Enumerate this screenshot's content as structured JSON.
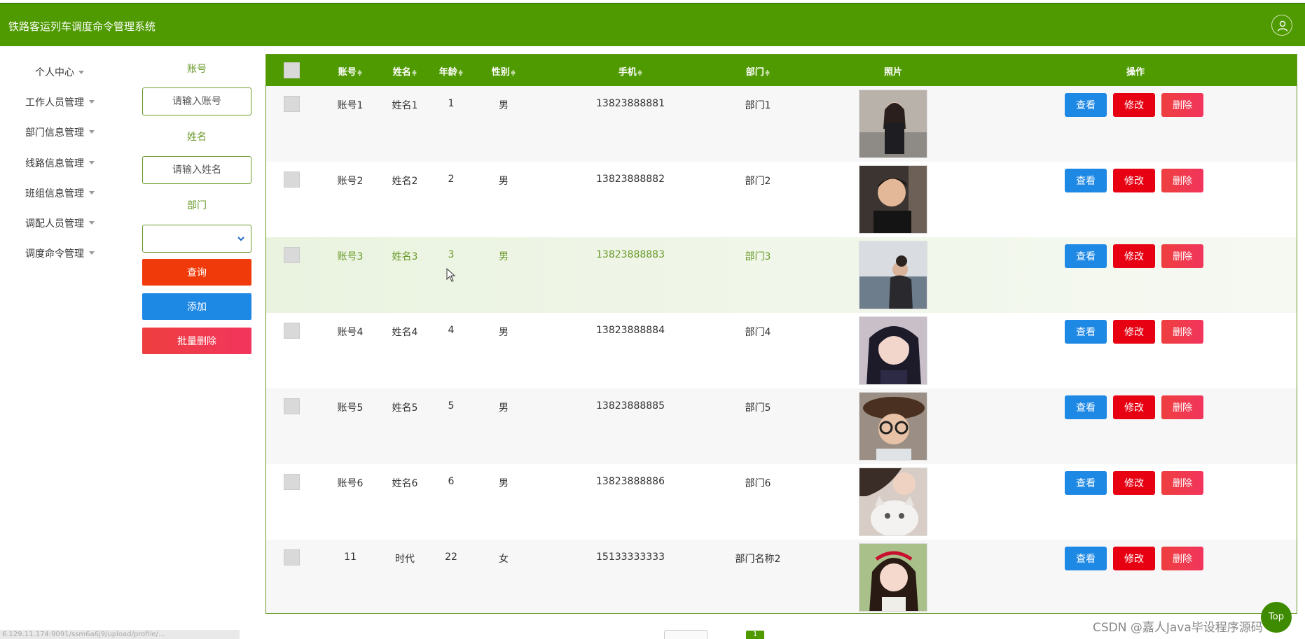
{
  "header": {
    "title": "铁路客运列车调度命令管理系统",
    "user_icon": "user-icon"
  },
  "sidebar": {
    "items": [
      {
        "label": "个人中心"
      },
      {
        "label": "工作人员管理"
      },
      {
        "label": "部门信息管理"
      },
      {
        "label": "线路信息管理"
      },
      {
        "label": "班组信息管理"
      },
      {
        "label": "调配人员管理"
      },
      {
        "label": "调度命令管理"
      }
    ]
  },
  "search": {
    "account_label": "账号",
    "account_placeholder": "请输入账号",
    "name_label": "姓名",
    "name_placeholder": "请输入姓名",
    "dept_label": "部门",
    "dept_value": "",
    "query_label": "查询",
    "add_label": "添加",
    "batch_delete_label": "批量删除"
  },
  "table": {
    "columns": {
      "account": "账号",
      "name": "姓名",
      "age": "年龄",
      "gender": "性别",
      "phone": "手机",
      "dept": "部门",
      "photo": "照片",
      "ops": "操作",
      "sort_glyph": "≑"
    },
    "actions": {
      "view": "查看",
      "edit": "修改",
      "delete": "删除"
    },
    "rows": [
      {
        "account": "账号1",
        "name": "姓名1",
        "age": "1",
        "gender": "男",
        "phone": "13823888881",
        "dept": "部门1"
      },
      {
        "account": "账号2",
        "name": "姓名2",
        "age": "2",
        "gender": "男",
        "phone": "13823888882",
        "dept": "部门2"
      },
      {
        "account": "账号3",
        "name": "姓名3",
        "age": "3",
        "gender": "男",
        "phone": "13823888883",
        "dept": "部门3"
      },
      {
        "account": "账号4",
        "name": "姓名4",
        "age": "4",
        "gender": "男",
        "phone": "13823888884",
        "dept": "部门4"
      },
      {
        "account": "账号5",
        "name": "姓名5",
        "age": "5",
        "gender": "男",
        "phone": "13823888885",
        "dept": "部门5"
      },
      {
        "account": "账号6",
        "name": "姓名6",
        "age": "6",
        "gender": "男",
        "phone": "13823888886",
        "dept": "部门6"
      },
      {
        "account": "11",
        "name": "时代",
        "age": "22",
        "gender": "女",
        "phone": "15133333333",
        "dept": "部门名称2"
      }
    ]
  },
  "footer": {
    "status_url": "6.129.11.174:9091/ssm6a6j9/upload/profile/...",
    "current_page": "1",
    "watermark": "CSDN @嘉人Java毕设程序源码",
    "top_label": "Top"
  },
  "colors": {
    "brand_green": "#4f9a00",
    "view_blue": "#1e88e5",
    "edit_red": "#e60012",
    "query_orange": "#f03a0a"
  }
}
